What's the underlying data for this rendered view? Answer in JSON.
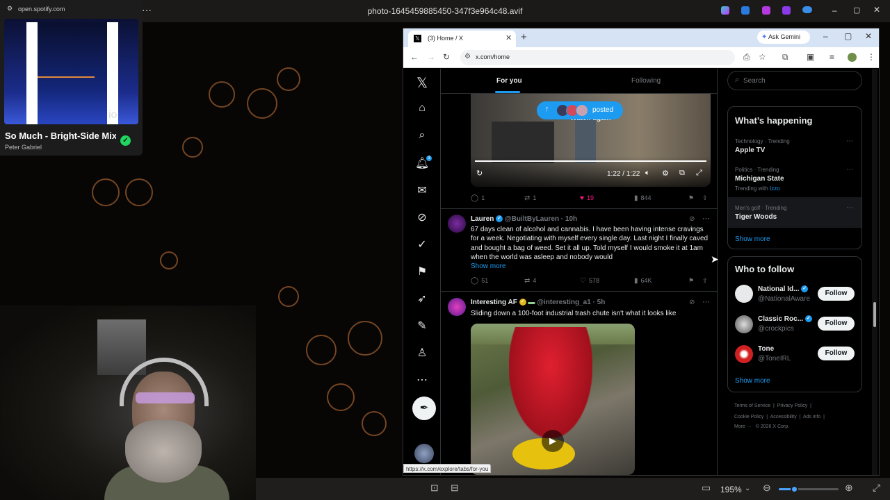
{
  "viewer": {
    "filename": "photo-1645459885450-347f3e964c48.avif",
    "zoom": "195%",
    "zoom_level": 0.26
  },
  "spotify": {
    "url": "open.spotify.com",
    "title": "So Much - Bright-Side Mix",
    "artist": "Peter Gabriel",
    "art_corner": "io"
  },
  "browser": {
    "tab_title": "(3) Home / X",
    "url": "x.com/home",
    "ask_gemini": "Ask Gemini",
    "status_url": "https://x.com/explore/tabs/for-you"
  },
  "x": {
    "tabs": [
      "For you",
      "Following"
    ],
    "notification_count": "3",
    "posted_pill": "posted",
    "video1": {
      "overlay_text": "Watch again",
      "time": "1:22 / 1:22",
      "actions": {
        "replies": "1",
        "reposts": "1",
        "likes": "19",
        "views": "844"
      }
    },
    "posts": [
      {
        "name": "Lauren",
        "handle": "@BuiltByLauren",
        "time": "· 10h",
        "text": "67 days clean of alcohol and cannabis. I have been having intense cravings for a week. Negotiating with myself every single day. Last night I finally caved and bought a bag of weed. Set it all up. Told myself I would smoke it at 1am when the world was asleep and nobody would",
        "show_more": "Show more",
        "actions": {
          "replies": "51",
          "reposts": "4",
          "likes": "578",
          "views": "64K"
        }
      },
      {
        "name": "Interesting AF",
        "handle": "@interesting_a1",
        "time": "· 5h",
        "text": "Sliding down a 100-foot industrial trash chute isn't what it looks like"
      }
    ],
    "search_placeholder": "Search",
    "whats_happening": {
      "title": "What’s happening",
      "trends": [
        {
          "category": "Technology · Trending",
          "name": "Apple TV",
          "extra": ""
        },
        {
          "category": "Politics · Trending",
          "name": "Michigan State",
          "extra_prefix": "Trending with",
          "extra_link": "Izzo"
        },
        {
          "category": "Men's golf · Trending",
          "name": "Tiger Woods",
          "extra": ""
        }
      ],
      "show_more": "Show more"
    },
    "who_to_follow": {
      "title": "Who to follow",
      "accounts": [
        {
          "name": "National Id...",
          "handle": "@NationalAware",
          "button": "Follow"
        },
        {
          "name": "Classic Roc...",
          "handle": "@crockpics",
          "button": "Follow"
        },
        {
          "name": "Tone",
          "handle": "@ToneIRL",
          "button": "Follow"
        }
      ],
      "show_more": "Show more"
    },
    "footer": {
      "links1": "Terms of Service  |  Privacy Policy  |",
      "links2": "Cookie Policy  |  Accessibility  |  Ads info  |",
      "links3": "More ···   © 2026 X Corp."
    }
  },
  "colors": {
    "accent": "#1d9bf0",
    "like": "#f91880",
    "x_background": "#000000",
    "spotify_green": "#1ed760"
  },
  "icons": [
    "x-logo-icon",
    "home-icon",
    "search-icon",
    "bell-icon",
    "mail-icon",
    "grok-icon",
    "communities-icon",
    "bookmark-icon",
    "rocket-icon",
    "article-icon",
    "profile-icon",
    "more-icon",
    "feather-icon"
  ]
}
